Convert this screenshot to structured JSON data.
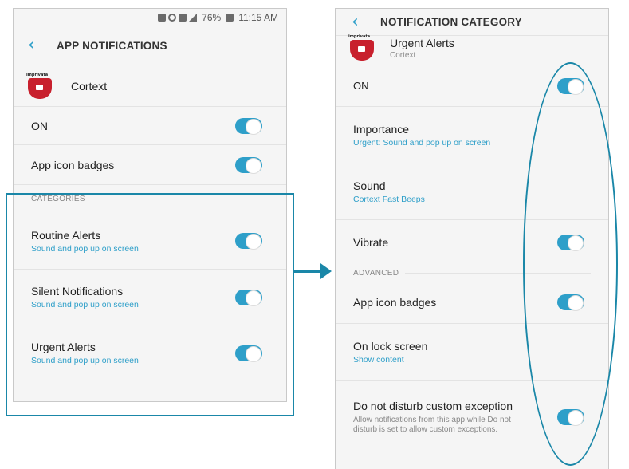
{
  "left": {
    "status": {
      "battery": "76%",
      "time": "11:15 AM"
    },
    "header": {
      "title": "APP NOTIFICATIONS"
    },
    "app": {
      "brand": "imprivata",
      "name": "Cortext"
    },
    "rows": [
      {
        "label": "ON"
      },
      {
        "label": "App icon badges"
      }
    ],
    "categories_label": "CATEGORIES",
    "categories": [
      {
        "label": "Routine Alerts",
        "sub": "Sound and pop up on screen"
      },
      {
        "label": "Silent Notifications",
        "sub": "Sound and pop up on screen"
      },
      {
        "label": "Urgent Alerts",
        "sub": "Sound and pop up on screen"
      }
    ]
  },
  "right": {
    "header": {
      "title": "NOTIFICATION CATEGORY"
    },
    "app": {
      "brand": "imprivata",
      "name": "Urgent Alerts",
      "sub": "Cortext"
    },
    "on_label": "ON",
    "importance": {
      "label": "Importance",
      "sub": "Urgent: Sound and pop up on screen"
    },
    "sound": {
      "label": "Sound",
      "sub": "Cortext Fast Beeps"
    },
    "vibrate": {
      "label": "Vibrate"
    },
    "advanced_label": "ADVANCED",
    "badges": {
      "label": "App icon badges"
    },
    "lock": {
      "label": "On lock screen",
      "sub": "Show content"
    },
    "dnd": {
      "label": "Do not disturb custom exception",
      "sub": "Allow notifications from this app while Do not disturb is set to allow custom exceptions."
    }
  },
  "colors": {
    "accent": "#2e9fc9",
    "annotation": "#1a87a8",
    "app_red": "#c8202d"
  },
  "icons": [
    "back-chevron-icon",
    "toggle-switch-icon",
    "app-icon",
    "arrow-icon"
  ]
}
